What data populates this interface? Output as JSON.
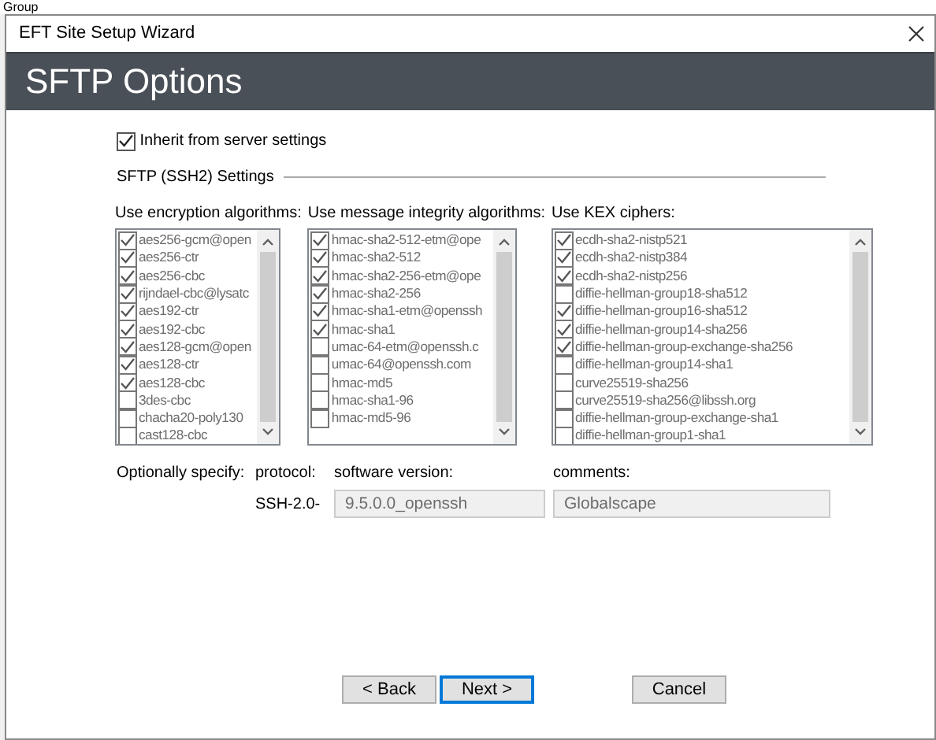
{
  "background": {
    "text": "Group"
  },
  "window": {
    "title": "EFT Site Setup Wizard"
  },
  "header": {
    "title": "SFTP Options"
  },
  "inherit": {
    "label": "Inherit from server settings",
    "checked": true
  },
  "section": {
    "title": "SFTP (SSH2) Settings"
  },
  "lists": [
    {
      "label": "Use encryption algorithms:",
      "disabled": true,
      "items": [
        {
          "text": "aes256-gcm@open",
          "checked": true
        },
        {
          "text": "aes256-ctr",
          "checked": true
        },
        {
          "text": "aes256-cbc",
          "checked": true
        },
        {
          "text": "rijndael-cbc@lysatc",
          "checked": true
        },
        {
          "text": "aes192-ctr",
          "checked": true
        },
        {
          "text": "aes192-cbc",
          "checked": true
        },
        {
          "text": "aes128-gcm@open",
          "checked": true
        },
        {
          "text": "aes128-ctr",
          "checked": true
        },
        {
          "text": "aes128-cbc",
          "checked": true
        },
        {
          "text": "3des-cbc",
          "checked": false
        },
        {
          "text": "chacha20-poly130",
          "checked": false
        },
        {
          "text": "cast128-cbc",
          "checked": false
        }
      ]
    },
    {
      "label": "Use message integrity algorithms:",
      "disabled": true,
      "items": [
        {
          "text": "hmac-sha2-512-etm@ope",
          "checked": true
        },
        {
          "text": "hmac-sha2-512",
          "checked": true
        },
        {
          "text": "hmac-sha2-256-etm@ope",
          "checked": true
        },
        {
          "text": "hmac-sha2-256",
          "checked": true
        },
        {
          "text": "hmac-sha1-etm@openssh",
          "checked": true
        },
        {
          "text": "hmac-sha1",
          "checked": true
        },
        {
          "text": "umac-64-etm@openssh.c",
          "checked": false
        },
        {
          "text": "umac-64@openssh.com",
          "checked": false
        },
        {
          "text": "hmac-md5",
          "checked": false
        },
        {
          "text": "hmac-sha1-96",
          "checked": false
        },
        {
          "text": "hmac-md5-96",
          "checked": false
        }
      ]
    },
    {
      "label": "Use KEX ciphers:",
      "disabled": true,
      "items": [
        {
          "text": "ecdh-sha2-nistp521",
          "checked": true
        },
        {
          "text": "ecdh-sha2-nistp384",
          "checked": true
        },
        {
          "text": "ecdh-sha2-nistp256",
          "checked": true
        },
        {
          "text": "diffie-hellman-group18-sha512",
          "checked": false
        },
        {
          "text": "diffie-hellman-group16-sha512",
          "checked": true
        },
        {
          "text": "diffie-hellman-group14-sha256",
          "checked": true
        },
        {
          "text": "diffie-hellman-group-exchange-sha256",
          "checked": true
        },
        {
          "text": "diffie-hellman-group14-sha1",
          "checked": false
        },
        {
          "text": "curve25519-sha256",
          "checked": false
        },
        {
          "text": "curve25519-sha256@libssh.org",
          "checked": false
        },
        {
          "text": "diffie-hellman-group-exchange-sha1",
          "checked": false
        },
        {
          "text": "diffie-hellman-group1-sha1",
          "checked": false
        }
      ]
    }
  ],
  "optional": {
    "label": "Optionally specify:",
    "protocol_label": "protocol:",
    "protocol_value": "SSH-2.0-",
    "version": {
      "label": "software version:",
      "value": "9.5.0.0_openssh",
      "disabled": true
    },
    "comments": {
      "label": "comments:",
      "value": "Globalscape",
      "disabled": true
    }
  },
  "buttons": [
    {
      "label": "< Back",
      "default": false
    },
    {
      "label": "Next >",
      "default": true
    },
    {
      "label": "Cancel",
      "default": false
    }
  ]
}
